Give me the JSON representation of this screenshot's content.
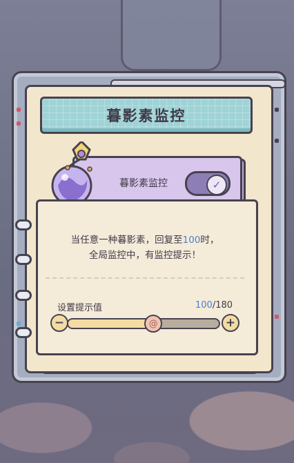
{
  "title": "暮影素监控",
  "monitor": {
    "label": "暮影素监控",
    "enabled": true
  },
  "notice": {
    "line1_prefix": "当任意一种暮影素，回复至",
    "line1_highlight": "100",
    "line1_suffix": "时，",
    "line2": "全局监控中，有监控提示！"
  },
  "threshold": {
    "label": "设置提示值",
    "current": "100",
    "separator": "/",
    "max": "180",
    "minus": "−",
    "plus": "+",
    "thumb_glyph": "@",
    "level_fraction": 0.556
  },
  "colors": {
    "highlight": "#4a7fcf",
    "banner": "#9fd3d6",
    "toggle_on": "#8d7fb5"
  }
}
